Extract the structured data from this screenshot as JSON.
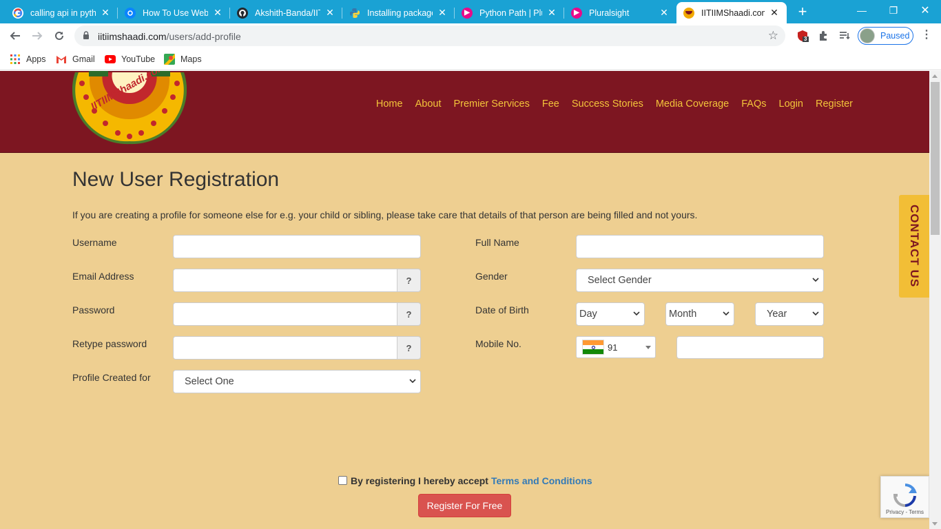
{
  "browser": {
    "tabs": [
      {
        "title": "calling api in pytho",
        "icon": "google-icon",
        "color": "#ffffff"
      },
      {
        "title": "How To Use Web A",
        "icon": "web-icon",
        "color": "#0a84ff"
      },
      {
        "title": "Akshith-Banda/IITI",
        "icon": "github-icon",
        "color": "#24292e"
      },
      {
        "title": "Installing packages",
        "icon": "python-icon",
        "color": "#3776ab"
      },
      {
        "title": "Python Path | Plura",
        "icon": "pluralsight-icon",
        "color": "#e80a89"
      },
      {
        "title": "Pluralsight",
        "icon": "pluralsight-icon",
        "color": "#e80a89"
      },
      {
        "title": "IITIIMShaadi.com",
        "icon": "site-favicon-icon",
        "color": "#f2a900"
      }
    ],
    "url_host": "iitiimshaadi.com",
    "url_path": "/users/add-profile",
    "profile_label": "Paused",
    "extension_badge": "3",
    "bookmarks": [
      {
        "label": "Apps",
        "icon": "apps-grid-icon"
      },
      {
        "label": "Gmail",
        "icon": "gmail-icon"
      },
      {
        "label": "YouTube",
        "icon": "youtube-icon"
      },
      {
        "label": "Maps",
        "icon": "maps-icon"
      }
    ]
  },
  "site": {
    "logo_text": "IITIIMShaadi.com",
    "nav": [
      "Home",
      "About",
      "Premier Services",
      "Fee",
      "Success Stories",
      "Media Coverage",
      "FAQs",
      "Login",
      "Register"
    ],
    "accent_color": "#f3c43a",
    "header_color": "#7d1621",
    "background_color": "#eecf91"
  },
  "form": {
    "title": "New User Registration",
    "intro": "If you are creating a profile for someone else for e.g. your child or sibling, please take care that details of that person are being filled and not yours.",
    "username_label": "Username",
    "email_label": "Email Address",
    "password_label": "Password",
    "retype_label": "Retype password",
    "profile_for_label": "Profile Created for",
    "profile_for_value": "Select One",
    "fullname_label": "Full Name",
    "gender_label": "Gender",
    "gender_value": "Select Gender",
    "dob_label": "Date of Birth",
    "dob_day": "Day",
    "dob_month": "Month",
    "dob_year": "Year",
    "mobile_label": "Mobile No.",
    "country_code": "91",
    "help_glyph": "?",
    "terms_prefix": "By registering I hereby accept",
    "terms_link": "Terms and Conditions",
    "submit_label": "Register For Free"
  },
  "contact_tab": "CONTACT US",
  "recaptcha_text": "Privacy - Terms"
}
